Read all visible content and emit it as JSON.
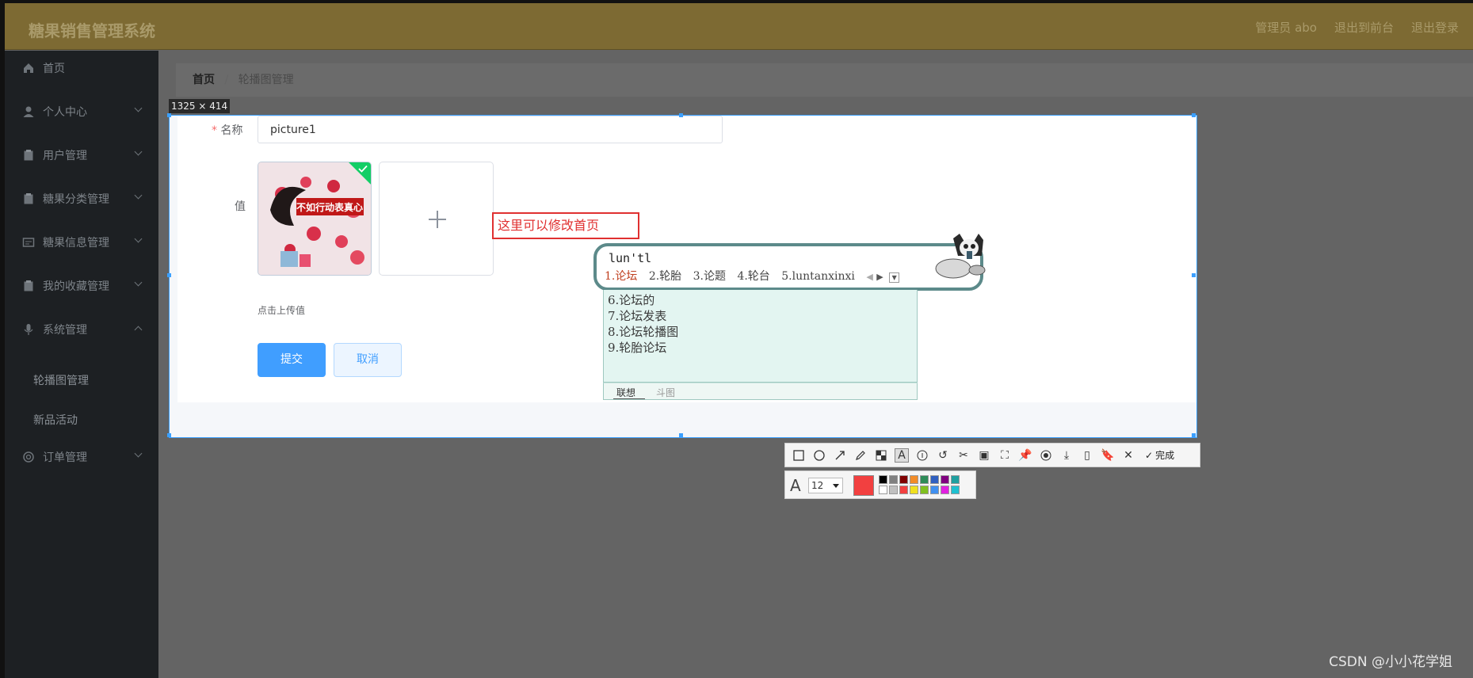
{
  "header": {
    "app_title": "糖果销售管理系统",
    "links": [
      "管理员 abo",
      "退出到前台",
      "退出登录"
    ]
  },
  "sidebar": {
    "items": [
      {
        "label": "首页",
        "icon": "home-icon"
      },
      {
        "label": "个人中心",
        "icon": "user-icon"
      },
      {
        "label": "用户管理",
        "icon": "clipboard-icon"
      },
      {
        "label": "糖果分类管理",
        "icon": "clipboard-icon"
      },
      {
        "label": "糖果信息管理",
        "icon": "card-icon"
      },
      {
        "label": "我的收藏管理",
        "icon": "clipboard-icon"
      },
      {
        "label": "系统管理",
        "icon": "mic-icon"
      },
      {
        "label": "订单管理",
        "icon": "circle-icon"
      }
    ],
    "sub_items": [
      "轮播图管理",
      "新品活动"
    ]
  },
  "breadcrumb": {
    "home": "首页",
    "separator": "/",
    "current": "轮播图管理"
  },
  "capture": {
    "dimensions": "1325 × 414"
  },
  "form": {
    "name_label": "名称",
    "required_mark": "*",
    "name_value": "picture1",
    "value_label": "值",
    "upload_tip": "点击上传值",
    "submit_label": "提交",
    "cancel_label": "取消"
  },
  "annotation": {
    "text": "这里可以修改首页"
  },
  "ime": {
    "input": "lun'tl",
    "candidates": [
      "1.论坛",
      "2.轮胎",
      "3.论题",
      "4.轮台",
      "5.luntanxinxi"
    ],
    "more": [
      "6.论坛的",
      "7.论坛发表",
      "8.论坛轮播图",
      "9.轮胎论坛"
    ],
    "tabs": [
      "联想",
      "斗图"
    ]
  },
  "toolbar": {
    "done_label": "完成",
    "font_size": "12",
    "current_color": "#f24040",
    "palette": [
      "#000000",
      "#808080",
      "#800000",
      "#f28c28",
      "#2e8b57",
      "#3060c0",
      "#800080",
      "#20a0a0",
      "#ffffff",
      "#c0c0c0",
      "#f24040",
      "#f0e020",
      "#80c020",
      "#4090f0",
      "#e020e0",
      "#20c0d0"
    ]
  },
  "watermark": "CSDN @小小花学姐"
}
